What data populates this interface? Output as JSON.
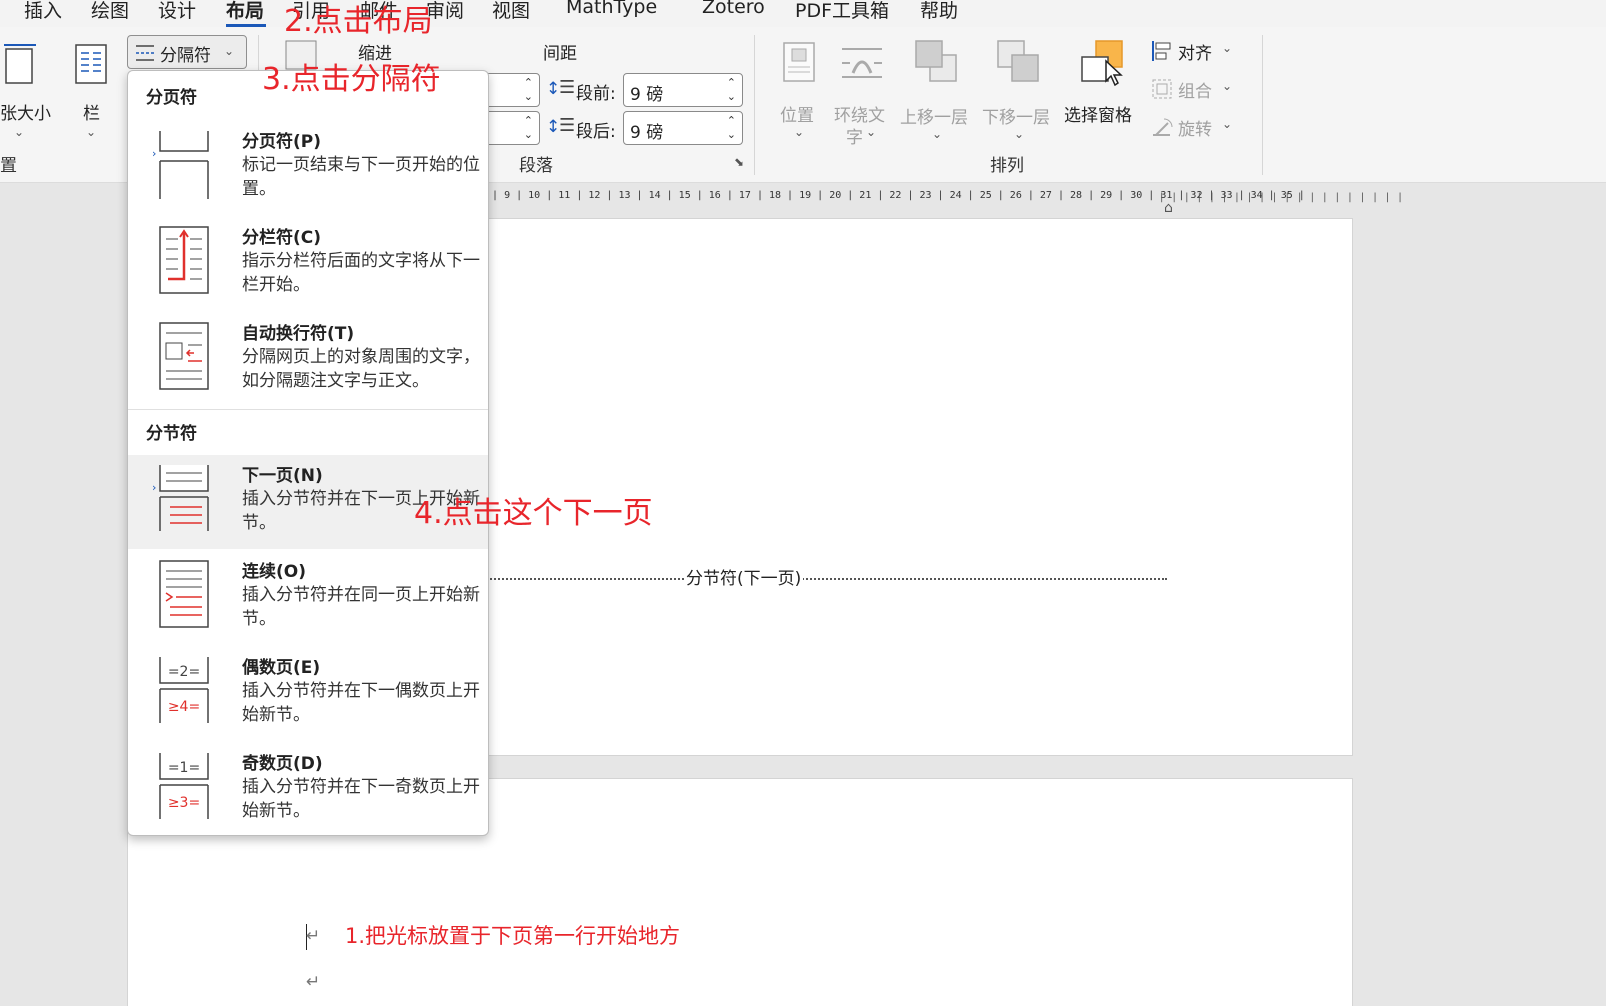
{
  "menubar": {
    "tabs": [
      "插入",
      "绘图",
      "设计",
      "布局",
      "引用",
      "邮件",
      "审阅",
      "视图",
      "MathType",
      "Zotero",
      "PDF工具箱",
      "帮助"
    ],
    "active": "布局"
  },
  "ribbon": {
    "page_setup": {
      "size_label": "张大小",
      "columns_label": "栏",
      "group_partial": "置",
      "breaks_label": "分隔符"
    },
    "paragraph": {
      "indent_label": "缩进",
      "spacing_label": "间距",
      "before_label": "段前:",
      "after_label": "段后:",
      "before_value": "9 磅",
      "after_value": "9 磅",
      "group_label": "段落"
    },
    "arrange": {
      "position": "位置",
      "wrap_text": [
        "环绕文",
        "字"
      ],
      "bring_forward": "上移一层",
      "send_backward": "下移一层",
      "selection_pane": "选择窗格",
      "align": "对齐",
      "group": "组合",
      "rotate": "旋转",
      "group_label": "排列"
    }
  },
  "ruler": {
    "text": "8 | 9 | 10 | 11 | 12 | 13 | 14 | 15 | 16 | 17 | 18 | 19 | 20 | 21 | 22 | 23 | 24 | 25 | 26 | 27 | 28 | 29 | 30 | 31 | 32 | 33 | 34 | 35 |",
    "ticks": "| | | | | | | | | | | | | | | | | | | |"
  },
  "document": {
    "section_break_label": "分节符(下一页)",
    "para_mark": "↵"
  },
  "dropdown": {
    "page_breaks_header": "分页符",
    "section_breaks_header": "分节符",
    "items": [
      {
        "title": "分页符(P)",
        "desc": "标记一页结束与下一页开始的位置。"
      },
      {
        "title": "分栏符(C)",
        "desc": "指示分栏符后面的文字将从下一栏开始。"
      },
      {
        "title": "自动换行符(T)",
        "desc": "分隔网页上的对象周围的文字，如分隔题注文字与正文。"
      },
      {
        "title": "下一页(N)",
        "desc": "插入分节符并在下一页上开始新节。"
      },
      {
        "title": "连续(O)",
        "desc": "插入分节符并在同一页上开始新节。"
      },
      {
        "title": "偶数页(E)",
        "desc": "插入分节符并在下一偶数页上开始新节。"
      },
      {
        "title": "奇数页(D)",
        "desc": "插入分节符并在下一奇数页上开始新节。"
      }
    ]
  },
  "annotations": {
    "step1": "1.把光标放置于下页第一行开始地方",
    "step2": "2.点击布局",
    "step3": "3.点击分隔符",
    "step4": "4.点击这个下一页"
  },
  "colors": {
    "annotation": "#e8252b",
    "accent": "#1b58b8",
    "icon_red": "#e0302c"
  }
}
